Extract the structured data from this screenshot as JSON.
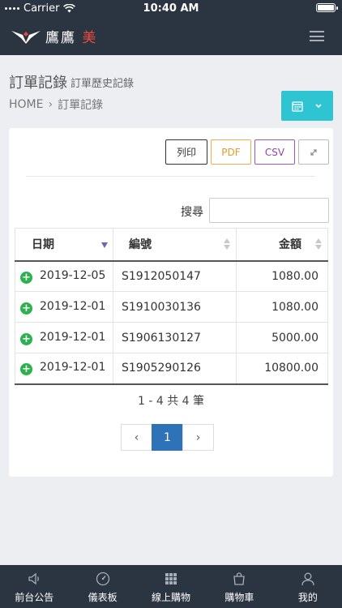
{
  "status_bar": {
    "carrier": "Carrier",
    "time": "10:40 AM"
  },
  "header": {
    "logo_text": "鷹鷹",
    "logo_accent": "美"
  },
  "page": {
    "title": "訂單記錄",
    "subtitle": "訂單歷史記錄"
  },
  "breadcrumb": {
    "home": "HOME",
    "separator": "›",
    "current": "訂單記錄"
  },
  "toolbar": {
    "print_label": "列印",
    "pdf_label": "PDF",
    "csv_label": "CSV"
  },
  "search": {
    "label": "搜尋",
    "value": "",
    "placeholder": ""
  },
  "table": {
    "columns": [
      "日期",
      "編號",
      "金額"
    ],
    "sort_column": "日期",
    "rows": [
      {
        "date": "2019-12-05",
        "id": "S1912050147",
        "amount": "1080.00"
      },
      {
        "date": "2019-12-01",
        "id": "S1910030136",
        "amount": "1080.00"
      },
      {
        "date": "2019-12-01",
        "id": "S1906130127",
        "amount": "5000.00"
      },
      {
        "date": "2019-12-01",
        "id": "S1905290126",
        "amount": "10800.00"
      }
    ]
  },
  "pagination": {
    "info": "1 - 4 共 4 筆",
    "prev": "‹",
    "current": "1",
    "next": "›"
  },
  "bottom_nav": [
    {
      "label": "前台公告",
      "icon": "speaker-icon"
    },
    {
      "label": "儀表板",
      "icon": "dashboard-icon"
    },
    {
      "label": "線上購物",
      "icon": "grid-icon"
    },
    {
      "label": "購物車",
      "icon": "bag-icon"
    },
    {
      "label": "我的",
      "icon": "user-icon"
    }
  ],
  "colors": {
    "header_bg": "#2b3441",
    "accent": "#2fc4d1",
    "logo_accent": "#e94b3c",
    "plus": "#2bb24c",
    "page_active": "#2e72b8"
  }
}
